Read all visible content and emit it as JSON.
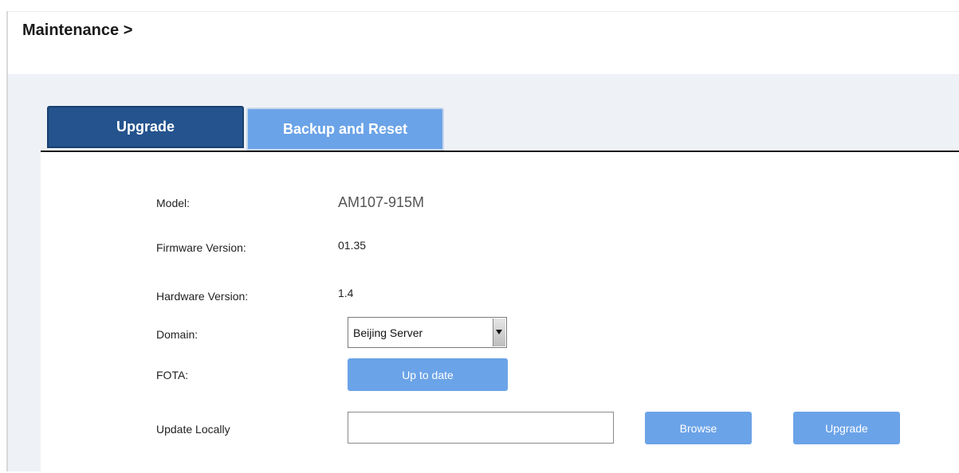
{
  "breadcrumb": "Maintenance >",
  "tabs": [
    {
      "label": "Upgrade",
      "active": true
    },
    {
      "label": "Backup and Reset",
      "active": false
    }
  ],
  "fields": {
    "model": {
      "label": "Model:",
      "value": "AM107-915M"
    },
    "firmware": {
      "label": "Firmware Version:",
      "value": "01.35"
    },
    "hardware": {
      "label": "Hardware Version:",
      "value": "1.4"
    },
    "domain": {
      "label": "Domain:",
      "selected": "Beijing Server"
    },
    "fota": {
      "label": "FOTA:",
      "button": "Up to date"
    },
    "update_locally": {
      "label": "Update Locally",
      "input_value": "",
      "browse_button": "Browse",
      "upgrade_button": "Upgrade"
    }
  },
  "colors": {
    "tab_active": "#24538e",
    "tab_inactive": "#6ba3e8",
    "button": "#6ba3e8",
    "content_bg": "#eef2f6"
  },
  "icons": {
    "select_arrow": "chevron-down-icon"
  }
}
